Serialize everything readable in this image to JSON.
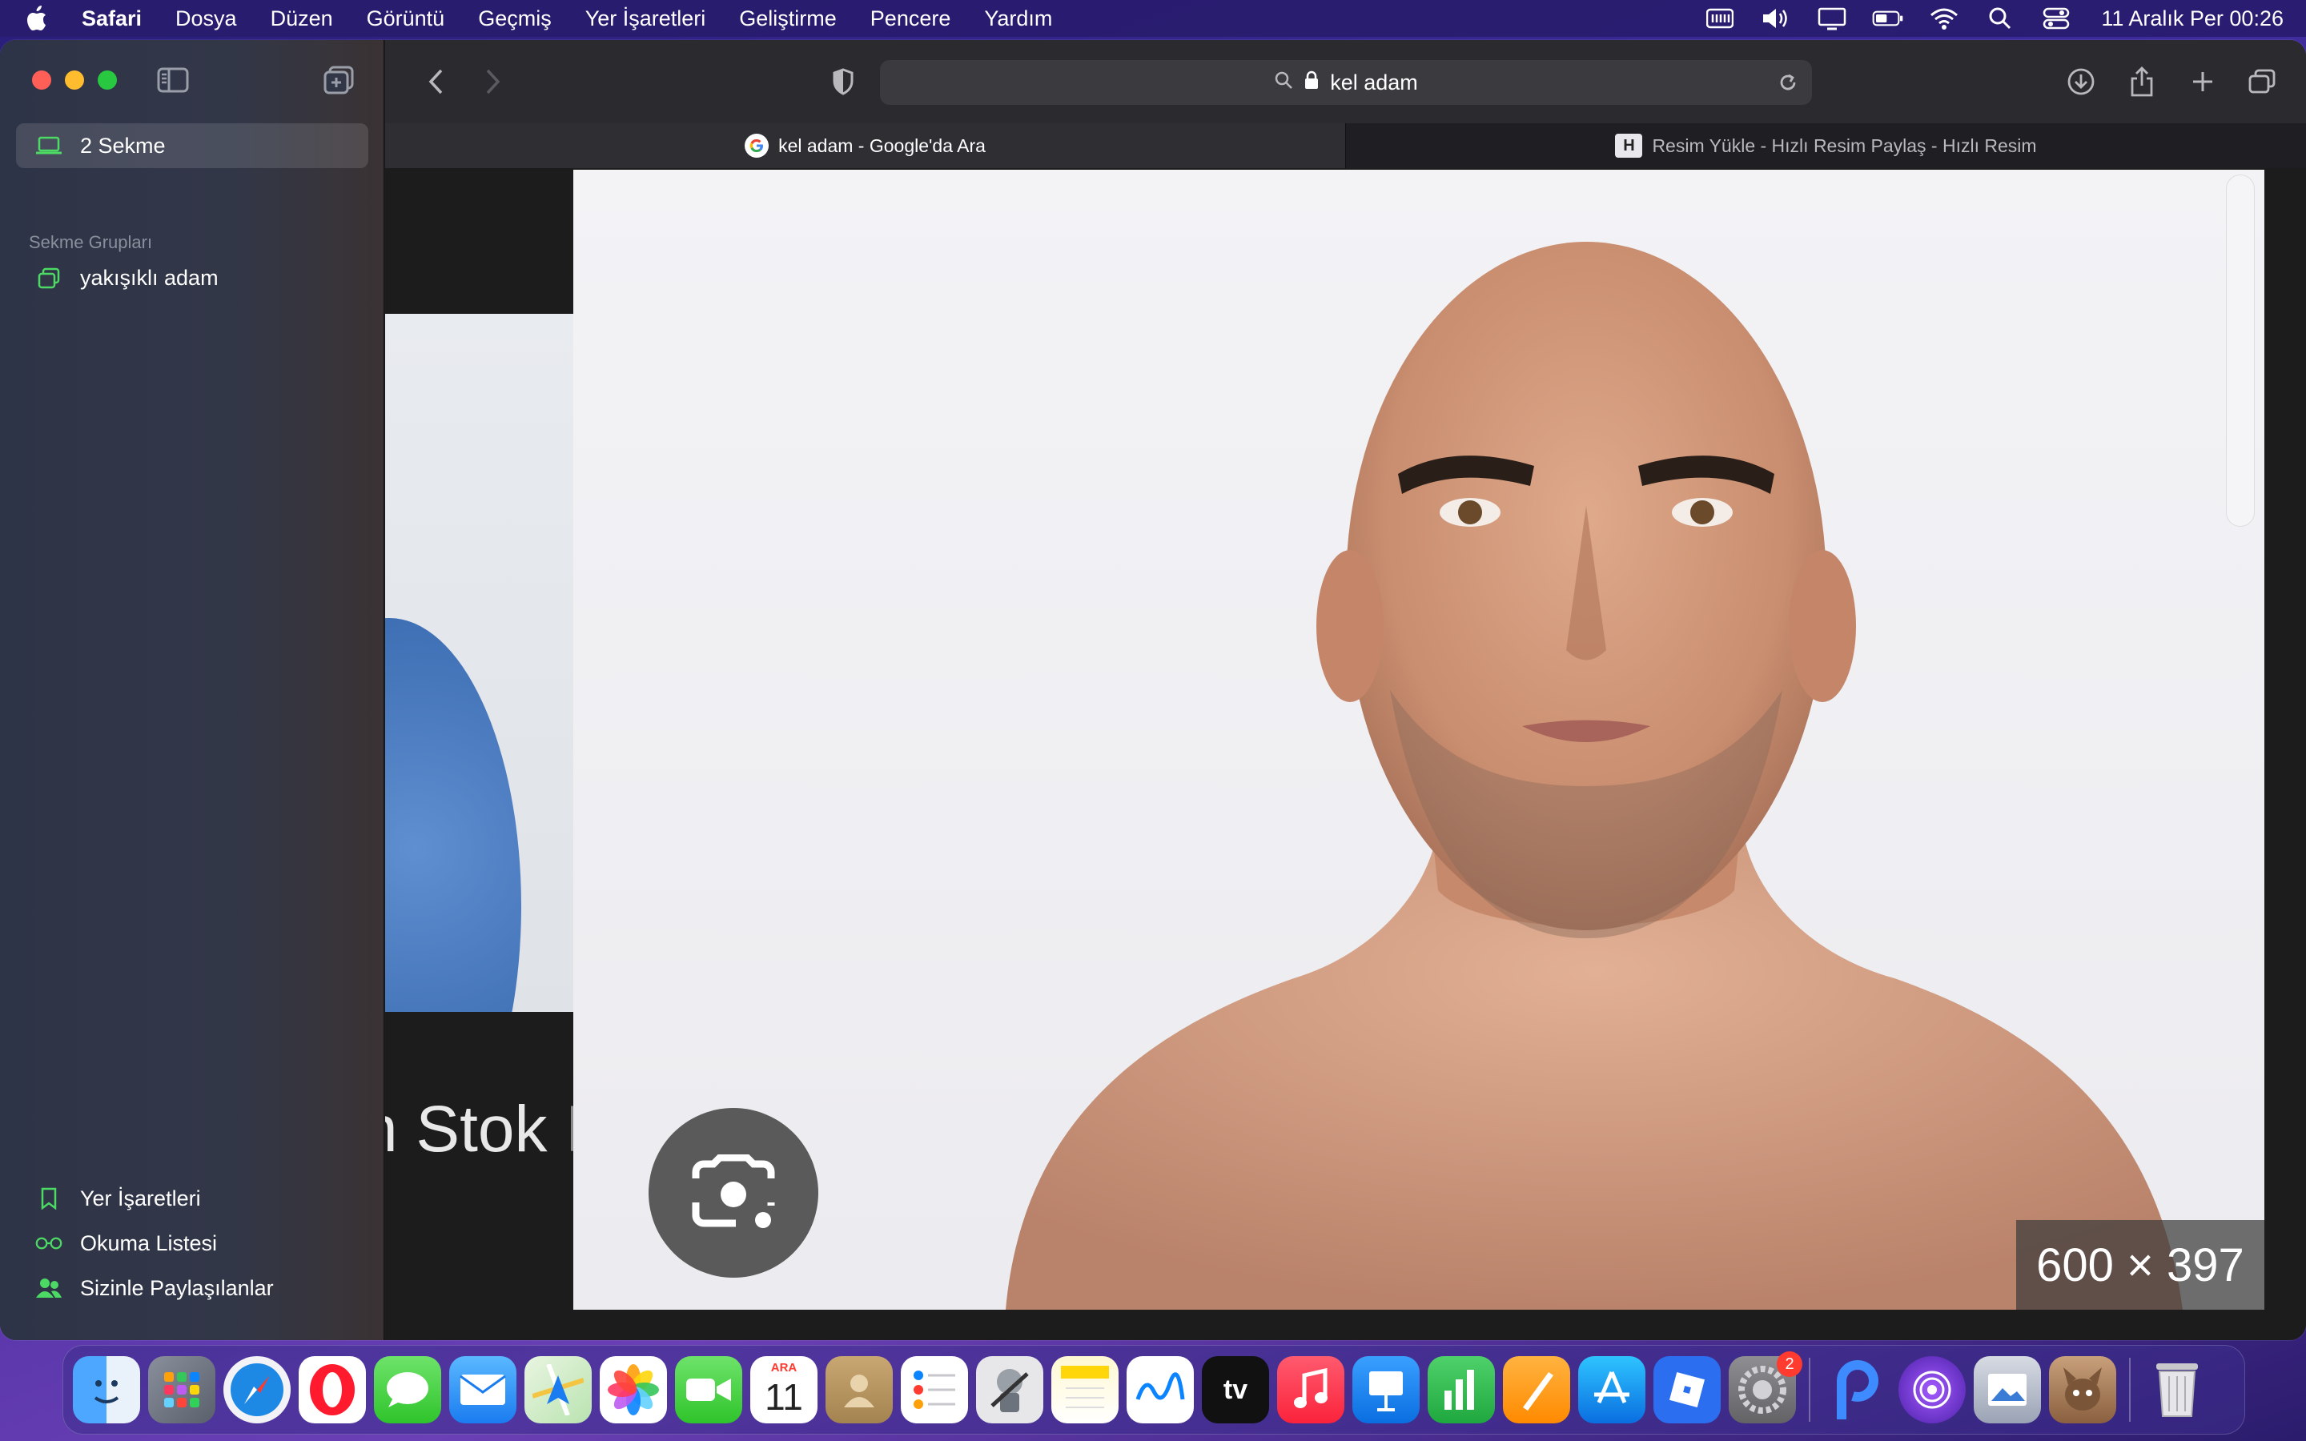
{
  "menubar": {
    "app_name": "Safari",
    "items": [
      "Dosya",
      "Düzen",
      "Görüntü",
      "Geçmiş",
      "Yer İşaretleri",
      "Geliştirme",
      "Pencere",
      "Yardım"
    ],
    "clock": "11 Aralık Per  00:26"
  },
  "sidebar": {
    "tabs_label": "2 Sekme",
    "section_title": "Sekme Grupları",
    "group_name": "yakışıklı adam",
    "bottom_items": [
      "Yer İşaretleri",
      "Okuma Listesi",
      "Sizinle Paylaşılanlar"
    ]
  },
  "toolbar": {
    "address_text": "kel adam"
  },
  "tabs": [
    {
      "title": "kel adam - Google'da Ara",
      "active": true
    },
    {
      "title": "Resim Yükle - Hızlı Resim Paylaş - Hızlı Resim",
      "active": false
    }
  ],
  "content": {
    "left_caption_main": "n Stok ",
    "left_caption_faded": "F",
    "image_dimensions": "600 × 397"
  },
  "dock": {
    "calendar_month": "ARA",
    "calendar_day": "11",
    "settings_badge": "2"
  },
  "colors": {
    "accent_green": "#4cd964",
    "traffic_red": "#ff5f57",
    "traffic_yellow": "#febc2e",
    "traffic_green": "#28c840"
  }
}
